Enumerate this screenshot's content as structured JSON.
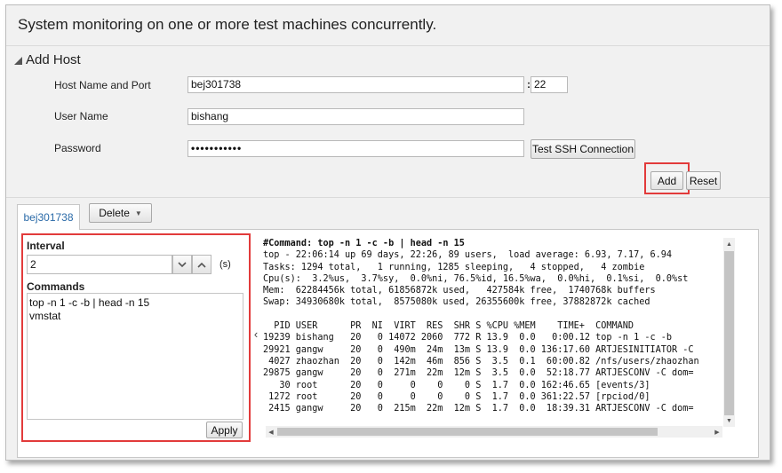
{
  "header": {
    "title": "System monitoring on one or more test machines concurrently."
  },
  "add_host": {
    "section_label": "Add Host",
    "host_label": "Host Name and Port",
    "host_value": "bej301738",
    "port_separator": ":",
    "port_value": "22",
    "user_label": "User Name",
    "user_value": "bishang",
    "password_label": "Password",
    "password_value": "•••••••••••",
    "test_ssh_label": "Test SSH Connection",
    "add_label": "Add",
    "reset_label": "Reset"
  },
  "tabs": {
    "active_tab": "bej301738",
    "delete_label": "Delete"
  },
  "monitor": {
    "interval_label": "Interval",
    "interval_value": "2",
    "interval_unit": "(s)",
    "commands_label": "Commands",
    "commands": [
      "top -n 1 -c -b | head -n 15",
      "vmstat"
    ],
    "apply_label": "Apply"
  },
  "terminal": {
    "command_line": "#Command: top -n 1 -c -b | head -n 15",
    "lines": [
      "top - 22:06:14 up 69 days, 22:26, 89 users,  load average: 6.93, 7.17, 6.94",
      "Tasks: 1294 total,   1 running, 1285 sleeping,   4 stopped,   4 zombie",
      "Cpu(s):  3.2%us,  3.7%sy,  0.0%ni, 76.5%id, 16.5%wa,  0.0%hi,  0.1%si,  0.0%st",
      "Mem:  62284456k total, 61856872k used,   427584k free,  1740768k buffers",
      "Swap: 34930680k total,  8575080k used, 26355600k free, 37882872k cached",
      "",
      "  PID USER      PR  NI  VIRT  RES  SHR S %CPU %MEM    TIME+  COMMAND",
      "19239 bishang   20   0 14072 2060  772 R 13.9  0.0   0:00.12 top -n 1 -c -b",
      "29921 gangw     20   0  490m  24m  13m S 13.9  0.0 136:17.60 ARTJESINITIATOR -C",
      " 4027 zhaozhan  20   0  142m  46m  856 S  3.5  0.1  60:00.82 /nfs/users/zhaozhan",
      "29875 gangw     20   0  271m  22m  12m S  3.5  0.0  52:18.77 ARTJESCONV -C dom=",
      "   30 root      20   0     0    0    0 S  1.7  0.0 162:46.65 [events/3]",
      " 1272 root      20   0     0    0    0 S  1.7  0.0 361:22.57 [rpciod/0]",
      " 2415 gangw     20   0  215m  22m  12m S  1.7  0.0  18:39.31 ARTJESCONV -C dom="
    ]
  },
  "colors": {
    "highlight": "#e23b3b",
    "tab_text": "#2a6aa8"
  }
}
